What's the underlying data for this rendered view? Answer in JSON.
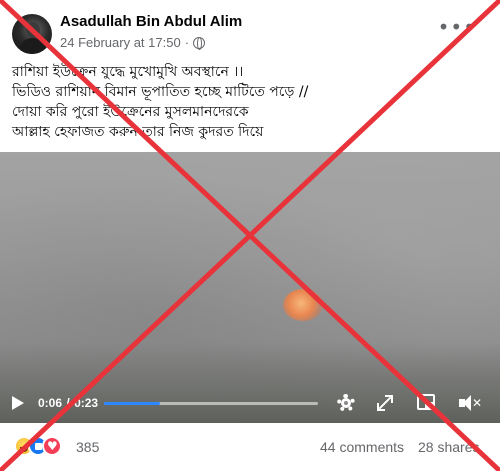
{
  "post": {
    "author": "Asadullah Bin Abdul Alim",
    "date": "24 February at 17:50",
    "date_separator": "·",
    "caption_lines": [
      "রাশিয়া ইউক্রেন যুদ্ধে মুখোমুখি অবস্থানে ।।",
      "ভিডিও রাশিয়ান বিমান ভূপাতিত হচ্ছে মাটিতে পড়ে //",
      "দোয়া করি পুরো ইউক্রেনের মুসলমানদেরকে",
      " আল্লাহ হেফাজত করুন তার নিজ কুদরত দিয়ে"
    ]
  },
  "video": {
    "current_time": "0:06",
    "time_separator": "/",
    "duration": "0:23",
    "progress_fraction": 0.26,
    "accent_color": "#2d88ff"
  },
  "footer": {
    "reaction_count": "385",
    "comments": "44 comments",
    "shares": "28 shares"
  },
  "overlay": {
    "color": "#e8333a"
  },
  "icons": [
    "avatar",
    "globe-icon",
    "more-icon",
    "play-icon",
    "gear-icon",
    "expand-icon",
    "pip-icon",
    "volume-icon",
    "haha-icon",
    "like-icon",
    "love-icon"
  ]
}
